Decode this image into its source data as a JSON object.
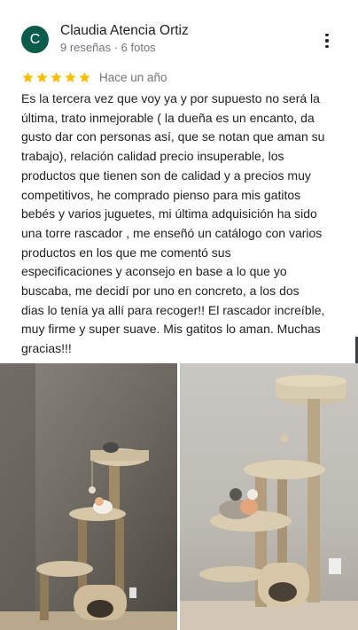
{
  "review": {
    "avatar_letter": "C",
    "author": "Claudia Atencia Ortiz",
    "author_meta": "9 reseñas · 6 fotos",
    "rating": 5,
    "rating_max": 5,
    "time": "Hace un año",
    "text": "Es la tercera vez que voy ya y por supuesto no será la\núltima, trato inmejorable ( la dueña es un encanto, da\ngusto dar con personas así, que se notan que aman su\ntrabajo), relación calidad precio insuperable, los\nproductos que tienen son de calidad y a precios muy\ncompetitivos, he comprado pienso para mis gatitos\nbebés y varios juguetes, mi última adquisición ha sido\nuna torre rascador , me enseñó un catálogo con varios\nproductos en los que me comentó sus\nespecificaciones y aconsejo en base a lo que yo\nbuscaba, me decidí por uno en concreto, a los dos\ndias lo tenía ya allí para recoger!! El rascador increíble,\nmuy firme y super suave. Mis gatitos lo aman. Muchas\ngracias!!!"
  },
  "photos": [
    {
      "icon": "cat-tree-photo"
    },
    {
      "icon": "cat-tree-photo"
    }
  ],
  "colors": {
    "avatar_bg": "#0b5b4b",
    "star": "#fbbc04",
    "meta_text": "#70757a"
  },
  "icons": {
    "more": "more-vert-icon",
    "star": "star-icon"
  }
}
